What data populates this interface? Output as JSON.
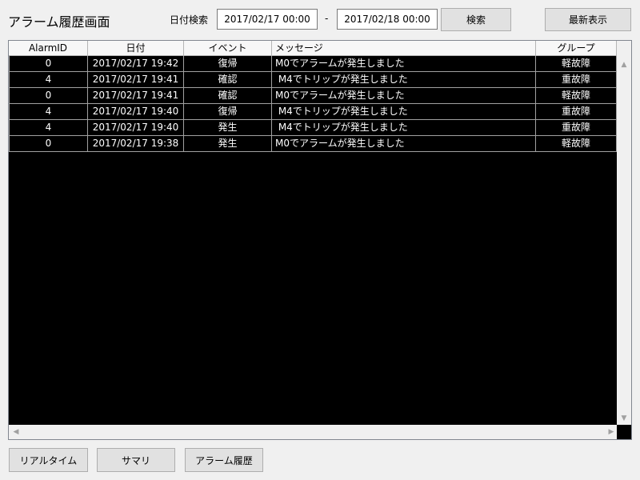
{
  "window": {
    "title": "アラーム履歴画面"
  },
  "search": {
    "date_label": "日付検索",
    "from_value": "2017/02/17 00:00",
    "separator": "-",
    "to_value": "2017/02/18 00:00",
    "search_button": "検索",
    "latest_button": "最新表示"
  },
  "table": {
    "columns": [
      "AlarmID",
      "日付",
      "イベント",
      "メッセージ",
      "グループ"
    ],
    "rows": [
      [
        "0",
        "2017/02/17 19:42",
        "復帰",
        "M0でアラームが発生しました",
        "軽故障"
      ],
      [
        "4",
        "2017/02/17 19:41",
        "確認",
        " M4でトリップが発生しました",
        "重故障"
      ],
      [
        "0",
        "2017/02/17 19:41",
        "確認",
        "M0でアラームが発生しました",
        "軽故障"
      ],
      [
        "4",
        "2017/02/17 19:40",
        "復帰",
        " M4でトリップが発生しました",
        "重故障"
      ],
      [
        "4",
        "2017/02/17 19:40",
        "発生",
        " M4でトリップが発生しました",
        "重故障"
      ],
      [
        "0",
        "2017/02/17 19:38",
        "発生",
        "M0でアラームが発生しました",
        "軽故障"
      ]
    ]
  },
  "scroll_icons": {
    "up": "▲",
    "down": "▼",
    "left": "◀",
    "right": "▶"
  },
  "footer": {
    "realtime_button": "リアルタイム",
    "summary_button": "サマリ",
    "history_button": "アラーム履歴"
  },
  "colors": {
    "grid_background": "#000000",
    "grid_text": "#ffffff",
    "window_background": "#f0f0f0"
  }
}
